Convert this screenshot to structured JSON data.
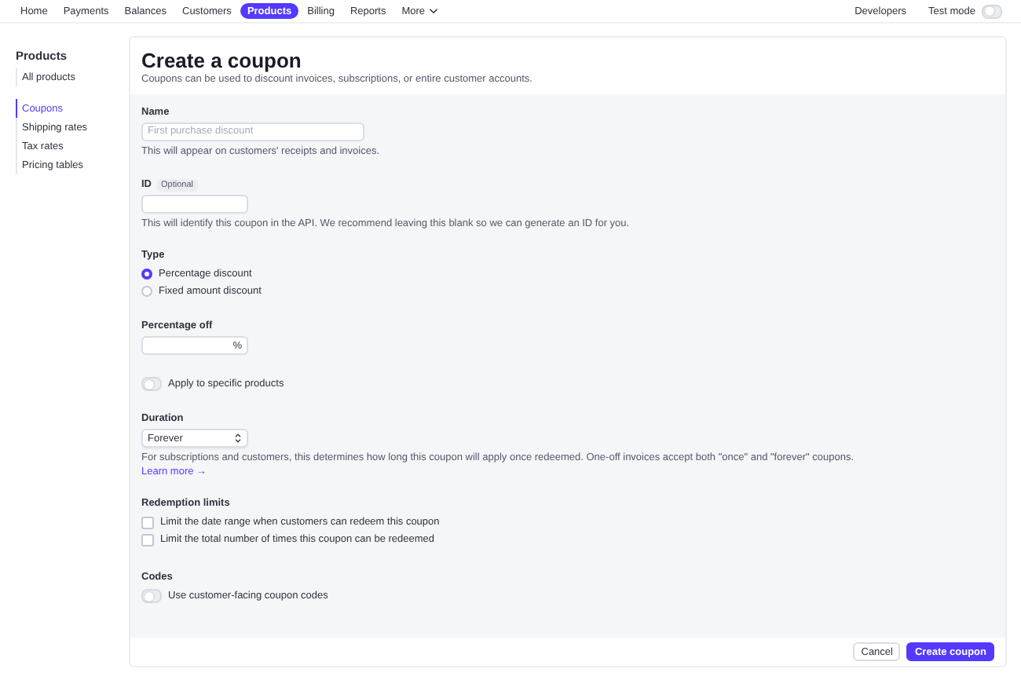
{
  "nav": {
    "items": [
      {
        "label": "Home",
        "selected": false
      },
      {
        "label": "Payments",
        "selected": false
      },
      {
        "label": "Balances",
        "selected": false
      },
      {
        "label": "Customers",
        "selected": false
      },
      {
        "label": "Products",
        "selected": true
      },
      {
        "label": "Billing",
        "selected": false
      },
      {
        "label": "Reports",
        "selected": false
      },
      {
        "label": "More",
        "selected": false,
        "dropdown": true
      }
    ],
    "developers": "Developers",
    "test_mode": {
      "label": "Test mode",
      "on": false
    }
  },
  "sidebar": {
    "title": "Products",
    "groups": [
      {
        "items": [
          {
            "label": "All products",
            "selected": false
          }
        ]
      },
      {
        "items": [
          {
            "label": "Coupons",
            "selected": true
          },
          {
            "label": "Shipping rates",
            "selected": false
          },
          {
            "label": "Tax rates",
            "selected": false
          },
          {
            "label": "Pricing tables",
            "selected": false
          }
        ]
      }
    ]
  },
  "page": {
    "title": "Create a coupon",
    "subtitle": "Coupons can be used to discount invoices, subscriptions, or entire customer accounts."
  },
  "name": {
    "label": "Name",
    "placeholder": "First purchase discount",
    "help": "This will appear on customers' receipts and invoices."
  },
  "id": {
    "label": "ID",
    "badge": "Optional",
    "help": "This will identify this coupon in the API. We recommend leaving this blank so we can generate an ID for you."
  },
  "type": {
    "label": "Type",
    "options": [
      {
        "label": "Percentage discount",
        "selected": true
      },
      {
        "label": "Fixed amount discount",
        "selected": false
      }
    ]
  },
  "percentage": {
    "label": "Percentage off",
    "suffix": "%"
  },
  "apply_products": {
    "label": "Apply to specific products",
    "on": false
  },
  "duration": {
    "label": "Duration",
    "value": "Forever",
    "help": "For subscriptions and customers, this determines how long this coupon will apply once redeemed. One-off invoices accept both \"once\" and \"forever\" coupons.",
    "link": "Learn more →"
  },
  "redemption": {
    "label": "Redemption limits",
    "options": [
      {
        "label": "Limit the date range when customers can redeem this coupon",
        "checked": false
      },
      {
        "label": "Limit the total number of times this coupon can be redeemed",
        "checked": false
      }
    ]
  },
  "codes": {
    "label": "Codes",
    "toggle": {
      "label": "Use customer-facing coupon codes",
      "on": false
    }
  },
  "footer": {
    "cancel": "Cancel",
    "submit": "Create coupon"
  }
}
